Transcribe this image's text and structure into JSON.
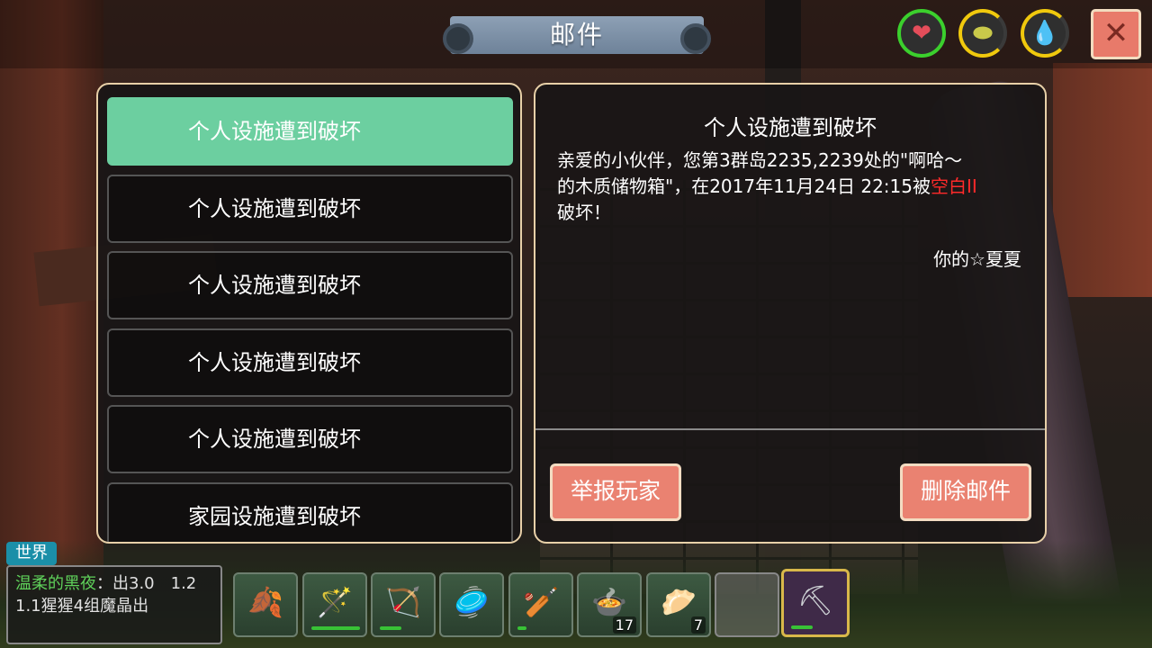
{
  "header": {
    "title": "邮件"
  },
  "status": {
    "health_icon": "heart-icon",
    "hunger_icon": "stomach-icon",
    "water_icon": "water-drop-icon",
    "close_label": "✕"
  },
  "mail_list": [
    {
      "subject": "个人设施遭到破坏",
      "selected": true
    },
    {
      "subject": "个人设施遭到破坏",
      "selected": false
    },
    {
      "subject": "个人设施遭到破坏",
      "selected": false
    },
    {
      "subject": "个人设施遭到破坏",
      "selected": false
    },
    {
      "subject": "个人设施遭到破坏",
      "selected": false
    },
    {
      "subject": "家园设施遭到破坏",
      "selected": false
    }
  ],
  "detail": {
    "title": "个人设施遭到破坏",
    "body_line1": "亲爱的小伙伴，您第3群岛2235,2239处的\"啊哈～",
    "body_line2_prefix": "的木质储物箱\"，在2017年11月24日 22:15被",
    "body_attacker": "空白II",
    "body_line3": "破坏！",
    "signature": "你的☆夏夏",
    "report_button": "举报玩家",
    "delete_button": "删除邮件"
  },
  "chat": {
    "tab_label": "世界",
    "sender": "温柔的黑夜",
    "message": "：出3.0　1.2　1.1猩猩4组魔晶出"
  },
  "hotbar": [
    {
      "name": "leaf-item-icon",
      "glyph": "🍂",
      "durability": null,
      "count": ""
    },
    {
      "name": "magic-staff-icon",
      "glyph": "🪄",
      "durability": 0.95,
      "count": ""
    },
    {
      "name": "bow-icon",
      "glyph": "🏹",
      "durability": 0.4,
      "count": ""
    },
    {
      "name": "stone-disc-icon",
      "glyph": "🥏",
      "durability": null,
      "count": ""
    },
    {
      "name": "wooden-club-icon",
      "glyph": "🏏",
      "durability": 0.15,
      "count": ""
    },
    {
      "name": "soup-bowl-icon",
      "glyph": "🍲",
      "durability": null,
      "count": "17"
    },
    {
      "name": "dumpling-bowl-icon",
      "glyph": "🥟",
      "durability": null,
      "count": "7"
    },
    {
      "name": "empty-slot",
      "glyph": "",
      "durability": null,
      "count": ""
    },
    {
      "name": "pickaxe-icon",
      "glyph": "⛏",
      "durability": 0.4,
      "count": ""
    }
  ],
  "colors": {
    "selected_mail": "#6ccfa0",
    "button": "#ea8271",
    "attacker_text": "#ff2a2a",
    "chat_sender": "#5fd15a",
    "health_ring": "#3bd02d",
    "hunger_ring": "#f0c90d"
  }
}
